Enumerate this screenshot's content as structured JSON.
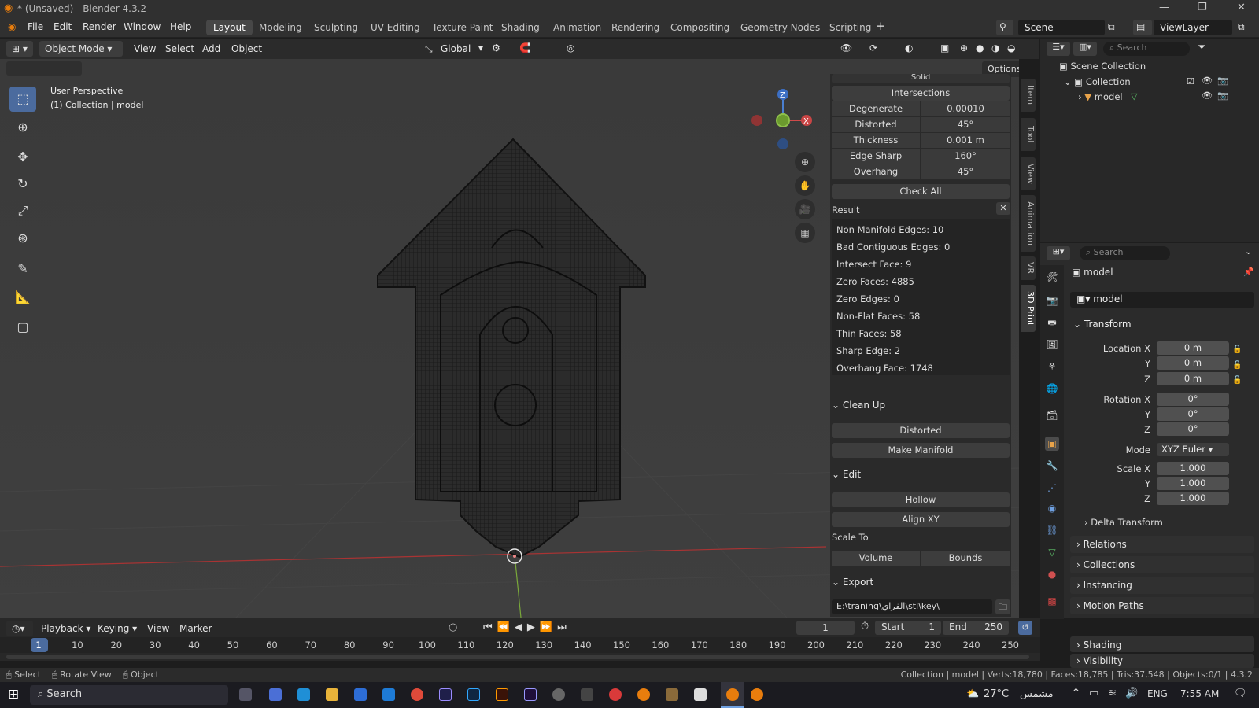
{
  "window": {
    "title": "* (Unsaved) - Blender 4.3.2"
  },
  "menu": [
    "File",
    "Edit",
    "Render",
    "Window",
    "Help"
  ],
  "workspaces": [
    "Layout",
    "Modeling",
    "Sculpting",
    "UV Editing",
    "Texture Paint",
    "Shading",
    "Animation",
    "Rendering",
    "Compositing",
    "Geometry Nodes",
    "Scripting"
  ],
  "active_workspace": "Layout",
  "scene": {
    "name": "Scene",
    "view_layer": "ViewLayer"
  },
  "header3d": {
    "mode": "Object Mode",
    "menus": [
      "View",
      "Select",
      "Add",
      "Object"
    ],
    "orientation": "Global",
    "options": "Options"
  },
  "viewport": {
    "perspective": "User Perspective",
    "collection_line": "(1) Collection | model",
    "axes": {
      "x": "X",
      "y": "Y",
      "z": "Z"
    }
  },
  "npanel": {
    "top_label": "Solid",
    "intersections": "Intersections",
    "rows": [
      {
        "k": "Degenerate",
        "v": "0.00010"
      },
      {
        "k": "Distorted",
        "v": "45°"
      },
      {
        "k": "Thickness",
        "v": "0.001 m"
      },
      {
        "k": "Edge Sharp",
        "v": "160°"
      },
      {
        "k": "Overhang",
        "v": "45°"
      }
    ],
    "check_all": "Check All",
    "result_label": "Result",
    "results": [
      "Non Manifold Edges: 10",
      "Bad Contiguous Edges: 0",
      "Intersect Face: 9",
      "Zero Faces: 4885",
      "Zero Edges: 0",
      "Non-Flat Faces: 58",
      "Thin Faces: 58",
      "Sharp Edge: 2",
      "Overhang Face: 1748"
    ],
    "cleanup": {
      "title": "Clean Up",
      "buttons": [
        "Distorted",
        "Make Manifold"
      ]
    },
    "edit": {
      "title": "Edit",
      "buttons": [
        "Hollow",
        "Align XY"
      ],
      "scale_to": "Scale To",
      "scale_buttons": [
        "Volume",
        "Bounds"
      ]
    },
    "export": {
      "title": "Export",
      "path": "E:\\traning\\ﺍﻟﻔﺮﺍﻱ\\stl\\key\\"
    }
  },
  "vertical_tabs": [
    "Item",
    "Tool",
    "View",
    "Animation",
    "VR",
    "3D Print"
  ],
  "outliner": {
    "search": "Search",
    "scene_collection": "Scene Collection",
    "collection": "Collection",
    "object": "model"
  },
  "properties": {
    "search": "Search",
    "object_name": "model",
    "data_name": "model",
    "transform_title": "Transform",
    "location": [
      {
        "l": "Location X",
        "v": "0 m"
      },
      {
        "l": "Y",
        "v": "0 m"
      },
      {
        "l": "Z",
        "v": "0 m"
      }
    ],
    "rotation": [
      {
        "l": "Rotation X",
        "v": "0°"
      },
      {
        "l": "Y",
        "v": "0°"
      },
      {
        "l": "Z",
        "v": "0°"
      }
    ],
    "mode_label": "Mode",
    "mode_value": "XYZ Euler",
    "scale": [
      {
        "l": "Scale X",
        "v": "1.000"
      },
      {
        "l": "Y",
        "v": "1.000"
      },
      {
        "l": "Z",
        "v": "1.000"
      }
    ],
    "delta": "Delta Transform",
    "sections": [
      "Relations",
      "Collections",
      "Instancing",
      "Motion Paths",
      "Shading",
      "Visibility"
    ]
  },
  "timeline": {
    "menus": [
      "Playback",
      "Keying",
      "View",
      "Marker"
    ],
    "current_frame": "1",
    "start_label": "Start",
    "start": "1",
    "end_label": "End",
    "end": "250",
    "ticks": [
      "1",
      "10",
      "20",
      "30",
      "40",
      "50",
      "60",
      "70",
      "80",
      "90",
      "100",
      "110",
      "120",
      "130",
      "140",
      "150",
      "160",
      "170",
      "180",
      "190",
      "200",
      "210",
      "220",
      "230",
      "240",
      "250"
    ]
  },
  "statusbar": {
    "hints": [
      "Select",
      "Rotate View",
      "Object"
    ],
    "stats": "Collection | model | Verts:18,780 | Faces:18,785 | Tris:37,548 | Objects:0/1 | 4.3.2"
  },
  "taskbar": {
    "search": "Search",
    "weather": "27°C",
    "weather_word": "ﻣﺸﻤﺲ",
    "lang": "ENG",
    "time": "7:55 AM"
  }
}
